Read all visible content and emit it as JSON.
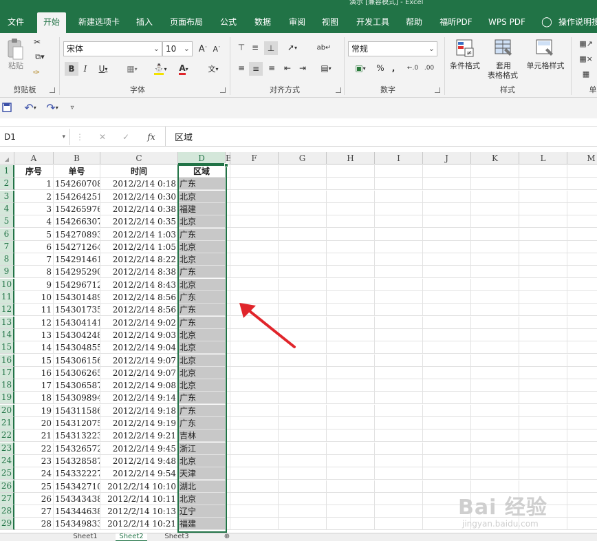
{
  "window": {
    "title": "演示 [兼容模式] - Excel"
  },
  "tabs": [
    {
      "label": "文件"
    },
    {
      "label": "开始"
    },
    {
      "label": "新建选项卡"
    },
    {
      "label": "插入"
    },
    {
      "label": "页面布局"
    },
    {
      "label": "公式"
    },
    {
      "label": "数据"
    },
    {
      "label": "审阅"
    },
    {
      "label": "视图"
    },
    {
      "label": "开发工具"
    },
    {
      "label": "帮助"
    },
    {
      "label": "福昕PDF"
    },
    {
      "label": "WPS PDF"
    },
    {
      "label": "操作说明搜"
    }
  ],
  "ribbon": {
    "paste_label": "粘贴",
    "font_name": "宋体",
    "font_size": "10",
    "number_format": "常规",
    "cond_format_label": "条件格式",
    "table_format_label1": "套用",
    "table_format_label2": "表格格式",
    "cell_style_label": "单元格样式",
    "groups": {
      "clipboard": "剪贴板",
      "font": "字体",
      "align": "对齐方式",
      "number": "数字",
      "styles": "样式",
      "cells": "单"
    },
    "wen_label": "wén"
  },
  "formula_bar": {
    "name_box": "D1",
    "fx": "fx",
    "content": "区域"
  },
  "grid": {
    "columns": [
      "A",
      "B",
      "C",
      "D",
      "E",
      "F",
      "G",
      "H",
      "I",
      "J",
      "K",
      "L",
      "M"
    ],
    "headers": [
      "序号",
      "单号",
      "时间",
      "区域"
    ],
    "rows": [
      [
        "1",
        "154260708",
        "2012/2/14 0:18",
        "广东"
      ],
      [
        "2",
        "154264251",
        "2012/2/14 0:30",
        "北京"
      ],
      [
        "3",
        "154265976",
        "2012/2/14 0:38",
        "福建"
      ],
      [
        "4",
        "154266307",
        "2012/2/14 0:35",
        "北京"
      ],
      [
        "5",
        "154270893",
        "2012/2/14 1:03",
        "广东"
      ],
      [
        "6",
        "154271264",
        "2012/2/14 1:05",
        "北京"
      ],
      [
        "7",
        "154291461",
        "2012/2/14 8:22",
        "北京"
      ],
      [
        "8",
        "154295290",
        "2012/2/14 8:38",
        "广东"
      ],
      [
        "9",
        "154296712",
        "2012/2/14 8:43",
        "北京"
      ],
      [
        "10",
        "154301489",
        "2012/2/14 8:56",
        "广东"
      ],
      [
        "11",
        "154301735",
        "2012/2/14 8:56",
        "广东"
      ],
      [
        "12",
        "154304141",
        "2012/2/14 9:02",
        "广东"
      ],
      [
        "13",
        "154304248",
        "2012/2/14 9:03",
        "北京"
      ],
      [
        "14",
        "154304855",
        "2012/2/14 9:04",
        "北京"
      ],
      [
        "15",
        "154306156",
        "2012/2/14 9:07",
        "北京"
      ],
      [
        "16",
        "154306265",
        "2012/2/14 9:07",
        "北京"
      ],
      [
        "17",
        "154306587",
        "2012/2/14 9:08",
        "北京"
      ],
      [
        "18",
        "154309894",
        "2012/2/14 9:14",
        "广东"
      ],
      [
        "19",
        "154311586",
        "2012/2/14 9:18",
        "广东"
      ],
      [
        "20",
        "154312075",
        "2012/2/14 9:19",
        "广东"
      ],
      [
        "21",
        "154313223",
        "2012/2/14 9:21",
        "吉林"
      ],
      [
        "22",
        "154326572",
        "2012/2/14 9:45",
        "浙江"
      ],
      [
        "23",
        "154328587",
        "2012/2/14 9:48",
        "北京"
      ],
      [
        "24",
        "154332227",
        "2012/2/14 9:54",
        "天津"
      ],
      [
        "25",
        "154342710",
        "2012/2/14 10:10",
        "湖北"
      ],
      [
        "26",
        "154343438",
        "2012/2/14 10:11",
        "北京"
      ],
      [
        "27",
        "154344638",
        "2012/2/14 10:13",
        "辽宁"
      ],
      [
        "28",
        "154349833",
        "2012/2/14 10:21",
        "福建"
      ]
    ]
  },
  "sheets": [
    "Sheet1",
    "Sheet2",
    "Sheet3"
  ],
  "watermark": {
    "main": "Bai  经验",
    "sub": "jingyan.baidu.com"
  },
  "colors": {
    "accent": "#217346",
    "selection": "#c8c8c8",
    "arrow": "#e0252b"
  }
}
